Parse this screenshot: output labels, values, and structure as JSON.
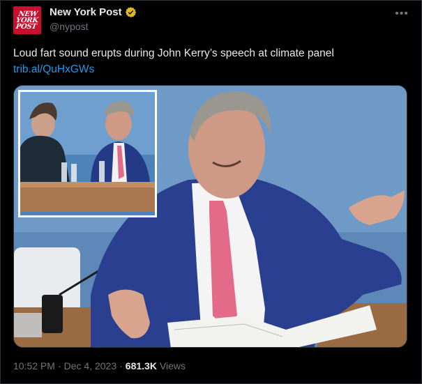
{
  "account": {
    "display_name": "New York Post",
    "handle": "@nypost",
    "logo_text": "NEW YORK POST",
    "verified_icon": "gold-verified-badge-icon"
  },
  "tweet": {
    "text": "Loud fart sound erupts during John Kerry’s speech at climate panel",
    "link": "trib.al/QuHxGWs"
  },
  "menu": {
    "more_icon": "more-options-icon"
  },
  "footer": {
    "time": "10:52 PM",
    "sep1": "·",
    "date": "Dec 4, 2023",
    "sep2": "·",
    "views_count": "681.3K",
    "views_label": "Views"
  },
  "colors": {
    "background": "#000000",
    "text": "#e7e9ea",
    "secondary": "#71767b",
    "link": "#1d9bf0",
    "brand_red": "#c8102e",
    "verified_gold": "#e2b719"
  }
}
